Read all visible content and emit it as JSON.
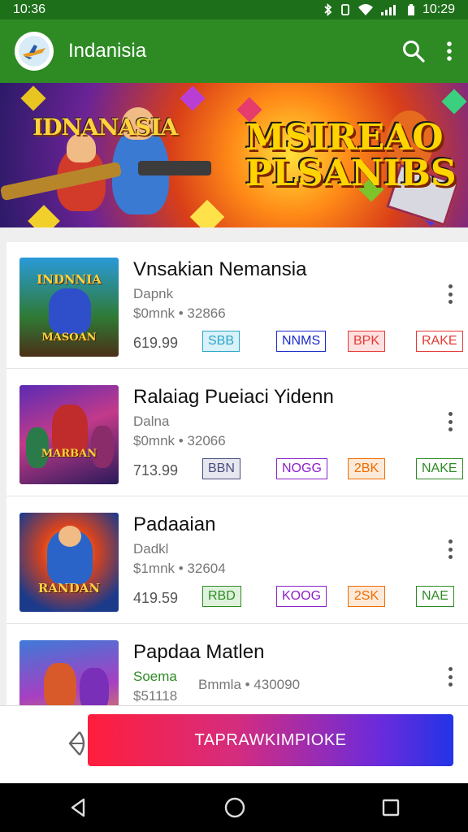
{
  "status_bar": {
    "time": "10:36",
    "right_time": "10:29"
  },
  "app_bar": {
    "title": "Indanisia",
    "search_icon": "search-icon",
    "menu_icon": "more-vert-icon"
  },
  "banner": {
    "left_title": "IDNANASIA",
    "right_title_line1": "MSIREAO",
    "right_title_line2": "PLSANIBS"
  },
  "games": [
    {
      "name": "Vnsakian Nemansia",
      "developer": "Dapnk",
      "meta": "$0mnk • 32866",
      "price": "619.99",
      "thumb_top": "INDNNIA",
      "thumb_bottom": "MASOAN",
      "tags": [
        {
          "label": "SBB",
          "color": "#2aa6c8",
          "bg": "#d9f1f8"
        },
        {
          "label": "NNMS",
          "color": "#1b2ac9",
          "bg": "#ffffff"
        },
        {
          "label": "BPK",
          "color": "#e53935",
          "bg": "#fde0df"
        },
        {
          "label": "RAKE",
          "color": "#e53935",
          "bg": "#ffffff"
        }
      ]
    },
    {
      "name": "Ralaiag Pueiaci Yidenn",
      "developer": "Dalna",
      "meta": "$0mnk • 32066",
      "price": "713.99",
      "thumb_top": "",
      "thumb_bottom": "MARBAN",
      "tags": [
        {
          "label": "BBN",
          "color": "#4a4f7a",
          "bg": "#e6e7ef"
        },
        {
          "label": "NOGG",
          "color": "#8d21c9",
          "bg": "#ffffff"
        },
        {
          "label": "2BK",
          "color": "#ef6c00",
          "bg": "#fde9d8"
        },
        {
          "label": "NAKE",
          "color": "#2e8b24",
          "bg": "#ffffff"
        }
      ]
    },
    {
      "name": "Padaaian",
      "developer": "Dadkl",
      "meta": "$1mnk • 32604",
      "price": "419.59",
      "thumb_top": "",
      "thumb_bottom": "RANDAN",
      "tags": [
        {
          "label": "RBD",
          "color": "#2e8b24",
          "bg": "#dff2dc"
        },
        {
          "label": "KOOG",
          "color": "#8d21c9",
          "bg": "#ffffff"
        },
        {
          "label": "2SK",
          "color": "#ef6c00",
          "bg": "#fde9d8"
        },
        {
          "label": "NAE",
          "color": "#2e8b24",
          "bg": "#ffffff"
        }
      ]
    },
    {
      "name": "Papdaa Matlen",
      "developer": "Soema",
      "developer_color": "#2e8b24",
      "meta": "$51118",
      "meta2": "Bmmla • 430090",
      "thumb_top": "",
      "thumb_bottom": ""
    }
  ],
  "cta_label": "TAPRAWKIMPIOKE",
  "colors": {
    "accent": "#2e8b24",
    "status": "#1e6f1a"
  }
}
